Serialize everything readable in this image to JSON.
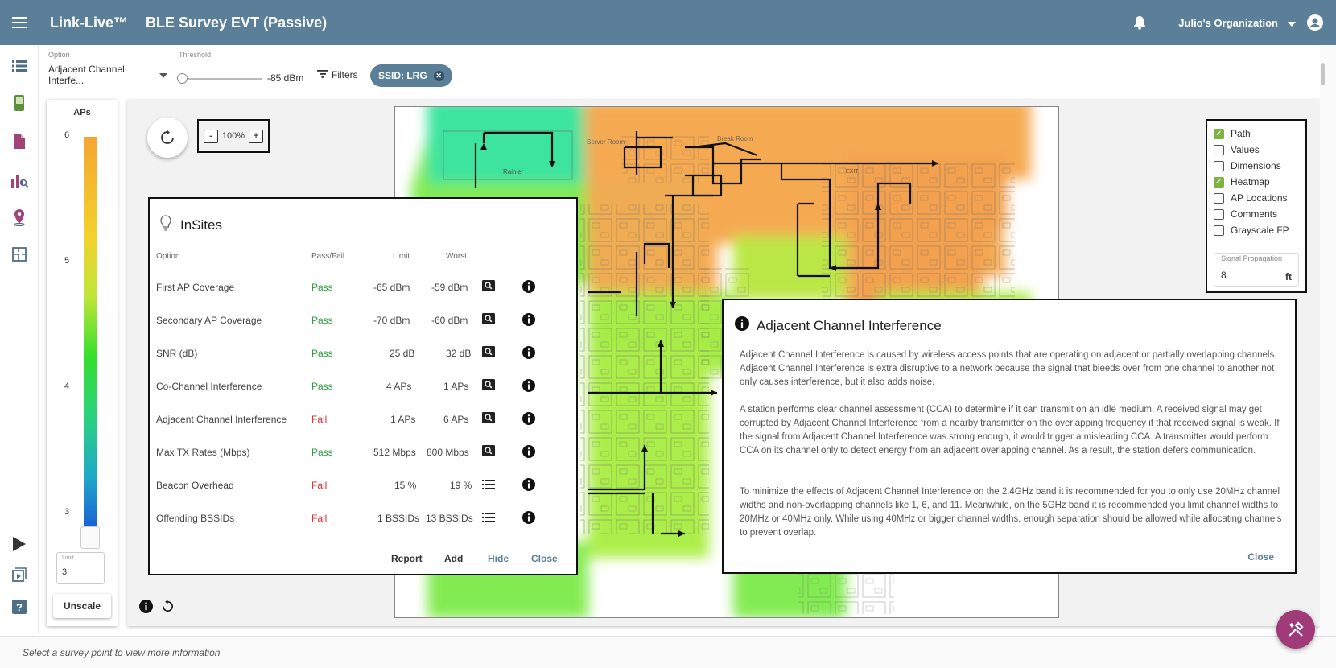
{
  "app": {
    "brand": "Link-Live™",
    "title": "BLE Survey EVT (Passive)",
    "org": "Julio's Organization"
  },
  "toolbar": {
    "option_label": "Option",
    "option_value": "Adjacent Channel Interfe...",
    "threshold_label": "Threshold",
    "threshold_value": "-85 dBm",
    "filters_label": "Filters",
    "chip_label": "SSID: LRG"
  },
  "scale": {
    "title": "APs",
    "ticks": [
      "6",
      "5",
      "4",
      "3"
    ],
    "limit_label": "Limit",
    "limit_value": "3",
    "unscale_label": "Unscale"
  },
  "zoom": {
    "minus": "-",
    "value": "100%",
    "plus": "+"
  },
  "layers": {
    "items": [
      {
        "label": "Path",
        "checked": true
      },
      {
        "label": "Values",
        "checked": false
      },
      {
        "label": "Dimensions",
        "checked": false
      },
      {
        "label": "Heatmap",
        "checked": true
      },
      {
        "label": "AP Locations",
        "checked": false
      },
      {
        "label": "Comments",
        "checked": false
      },
      {
        "label": "Grayscale FP",
        "checked": false
      }
    ],
    "signal_label": "Signal Propagation",
    "signal_value": "8",
    "signal_unit": "ft"
  },
  "insites": {
    "title": "InSites",
    "headers": {
      "option": "Option",
      "passfail": "Pass/Fail",
      "limit": "Limit",
      "worst": "Worst"
    },
    "rows": [
      {
        "option": "First AP Coverage",
        "status": "Pass",
        "limit": "-65 dBm",
        "worst": "-59 dBm",
        "action": "search-icon"
      },
      {
        "option": "Secondary AP Coverage",
        "status": "Pass",
        "limit": "-70 dBm",
        "worst": "-60 dBm",
        "action": "search-icon"
      },
      {
        "option": "SNR (dB)",
        "status": "Pass",
        "limit": "25 dB",
        "worst": "32 dB",
        "action": "search-icon"
      },
      {
        "option": "Co-Channel Interference",
        "status": "Pass",
        "limit": "4 APs",
        "worst": "1 APs",
        "action": "search-icon"
      },
      {
        "option": "Adjacent Channel Interference",
        "status": "Fail",
        "limit": "1 APs",
        "worst": "6 APs",
        "action": "search-icon"
      },
      {
        "option": "Max TX Rates (Mbps)",
        "status": "Pass",
        "limit": "512 Mbps",
        "worst": "800 Mbps",
        "action": "search-icon"
      },
      {
        "option": "Beacon Overhead",
        "status": "Fail",
        "limit": "15 %",
        "worst": "19 %",
        "action": "list-icon"
      },
      {
        "option": "Offending BSSIDs",
        "status": "Fail",
        "limit": "1 BSSIDs",
        "worst": "13 BSSIDs",
        "action": "list-icon"
      }
    ],
    "actions": {
      "report": "Report",
      "add": "Add",
      "hide": "Hide",
      "close": "Close"
    }
  },
  "aci": {
    "title": "Adjacent Channel Interference",
    "p1": "Adjacent Channel Interference is caused by wireless access points that are operating on adjacent or partially overlapping channels. Adjacent Channel Interference is extra disruptive to a network because the signal that bleeds over from one channel to another not only causes interference, but it also adds noise.",
    "p2": "A station performs clear channel assessment (CCA) to determine if it can transmit on an idle medium. A received signal may get corrupted by Adjacent Channel Interference from a nearby transmitter on the overlapping frequency if that received signal is weak. If the signal from Adjacent Channel Interference was strong enough, it would trigger a misleading CCA. A transmitter would perform CCA on its channel only to detect energy from an adjacent overlapping channel. As a result, the station defers communication.",
    "p3": "To minimize the effects of Adjacent Channel Interference on the 2.4GHz band it is recommended for you to only use 20MHz channel widths and non-overlapping channels like 1, 6, and 11. Meanwhile, on the 5GHz band it is recommended you limit channel widths to 20MHz or 40MHz only. While using 40MHz or bigger channel widths, enough separation should be allowed while allocating channels to prevent overlap.",
    "close": "Close"
  },
  "floorplan": {
    "rooms": [
      "Server Room",
      "Break Room",
      "Rainier",
      "EXIT"
    ]
  },
  "status": {
    "text": "Select a survey point to view more information"
  },
  "colors": {
    "accent": "#5b7f98",
    "fab": "#a03a78",
    "pass": "#2e9c3f",
    "fail": "#d33333"
  }
}
